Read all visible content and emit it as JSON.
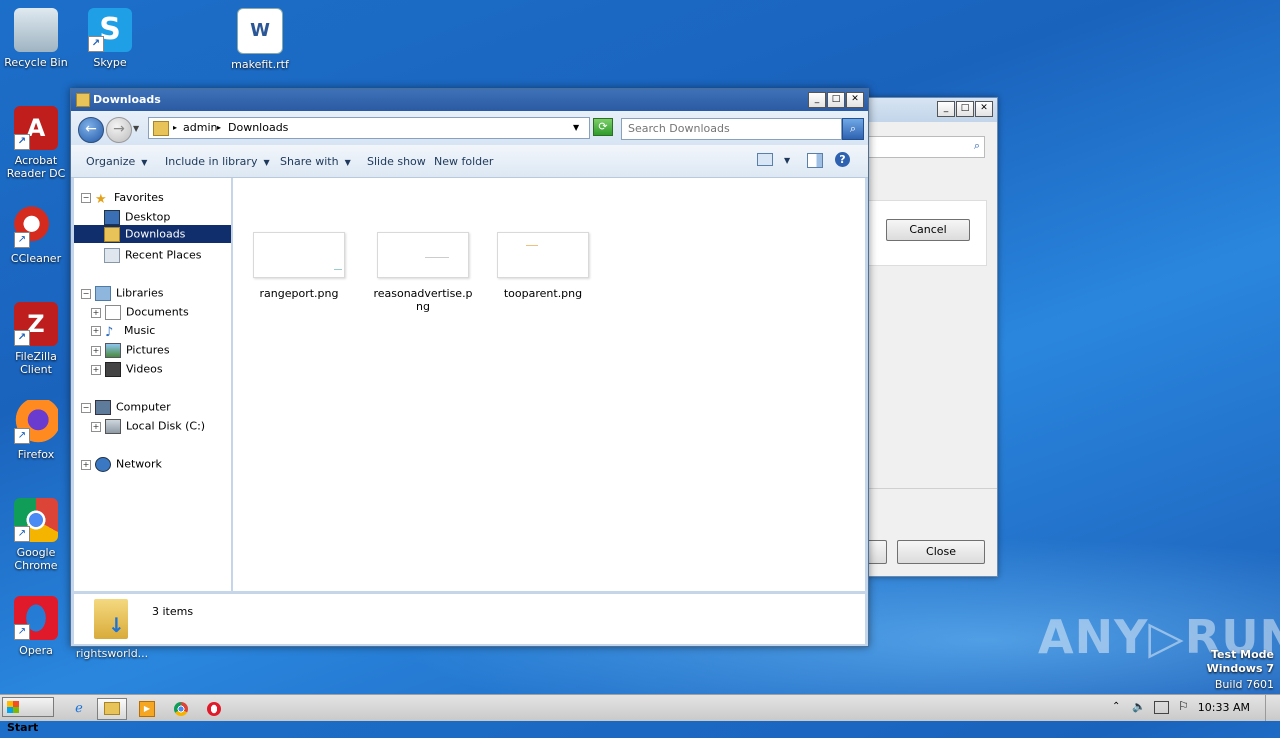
{
  "desktop": {
    "icons": [
      {
        "label": "Recycle Bin"
      },
      {
        "label": "Skype"
      },
      {
        "label": "makefit.rtf"
      },
      {
        "label": "Acrobat Reader DC"
      },
      {
        "label": "CCleaner"
      },
      {
        "label": "FileZilla Client"
      },
      {
        "label": "Firefox"
      },
      {
        "label": "Google Chrome"
      },
      {
        "label": "Opera"
      }
    ],
    "hidden_label": "rightsworld...",
    "watermark_brand": "ANY▷RUN",
    "watermark_lines": [
      "Test Mode",
      "Windows 7",
      "Build 7601"
    ]
  },
  "back_window": {
    "cancel_label": "Cancel",
    "close_label": "Close"
  },
  "explorer": {
    "title": "Downloads",
    "address": {
      "segment1": "admin",
      "segment2": "Downloads"
    },
    "search": {
      "placeholder": "Search Downloads"
    },
    "commands": {
      "organize": "Organize",
      "include": "Include in library",
      "share": "Share with",
      "slideshow": "Slide show",
      "newfolder": "New folder"
    },
    "nav": {
      "favorites": "Favorites",
      "desktop": "Desktop",
      "downloads": "Downloads",
      "recent": "Recent Places",
      "libraries": "Libraries",
      "documents": "Documents",
      "music": "Music",
      "pictures": "Pictures",
      "videos": "Videos",
      "computer": "Computer",
      "localdisk": "Local Disk (C:)",
      "network": "Network"
    },
    "files": [
      {
        "name": "rangeport.png"
      },
      {
        "name": "reasonadvertise.png"
      },
      {
        "name": "tooparent.png"
      }
    ],
    "status": "3 items"
  },
  "taskbar": {
    "start_label": "Start",
    "clock": "10:33 AM"
  },
  "colors": {
    "desktop_blue": "#1a63bd",
    "title_blue": "#2a5aa3",
    "selection": "#0f2e6b"
  }
}
